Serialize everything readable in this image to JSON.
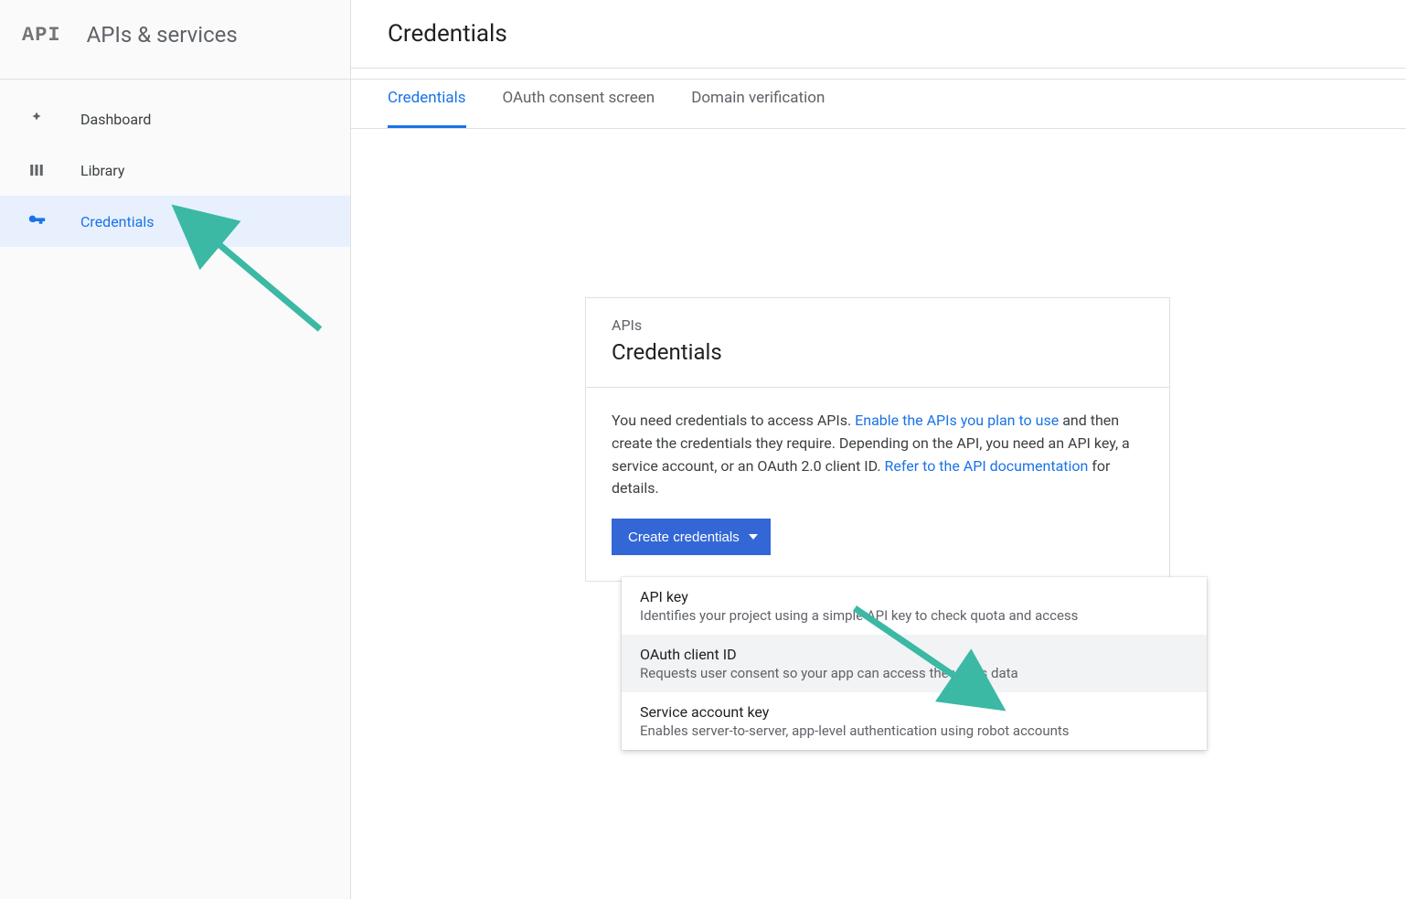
{
  "brand": {
    "mark": "API",
    "title": "APIs & services"
  },
  "nav": {
    "items": [
      {
        "label": "Dashboard"
      },
      {
        "label": "Library"
      },
      {
        "label": "Credentials"
      }
    ]
  },
  "page": {
    "title": "Credentials"
  },
  "tabs": {
    "items": [
      {
        "label": "Credentials"
      },
      {
        "label": "OAuth consent screen"
      },
      {
        "label": "Domain verification"
      }
    ]
  },
  "card": {
    "eyebrow": "APIs",
    "title": "Credentials",
    "body_pre": "You need credentials to access APIs. ",
    "link1": "Enable the APIs you plan to use",
    "body_mid": " and then create the credentials they require. Depending on the API, you need an API key, a service account, or an OAuth 2.0 client ID. ",
    "link2": "Refer to the API documentation",
    "body_post": " for details.",
    "button": "Create credentials"
  },
  "dropdown": {
    "items": [
      {
        "title": "API key",
        "sub": "Identifies your project using a simple API key to check quota and access"
      },
      {
        "title": "OAuth client ID",
        "sub": "Requests user consent so your app can access the user's data"
      },
      {
        "title": "Service account key",
        "sub": "Enables server-to-server, app-level authentication using robot accounts"
      }
    ]
  },
  "colors": {
    "accent": "#1a73e8",
    "button": "#3367d6",
    "arrow": "#3bb9a4"
  }
}
